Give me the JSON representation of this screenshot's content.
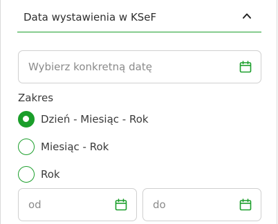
{
  "accordion": {
    "title": "Data wystawienia w KSeF"
  },
  "date_picker": {
    "placeholder": "Wybierz konkretną datę"
  },
  "range": {
    "label": "Zakres",
    "options": [
      {
        "label": "Dzień - Miesiąc - Rok",
        "selected": true
      },
      {
        "label": "Miesiąc - Rok",
        "selected": false
      },
      {
        "label": "Rok",
        "selected": false
      }
    ]
  },
  "from_field": {
    "placeholder": "od"
  },
  "to_field": {
    "placeholder": "do"
  },
  "colors": {
    "accent": "#1a9e2a",
    "border": "#cfcfcf",
    "placeholder": "#8a8a8a"
  },
  "icons": {
    "collapse": "chevron-up-icon",
    "calendar": "calendar-icon"
  }
}
